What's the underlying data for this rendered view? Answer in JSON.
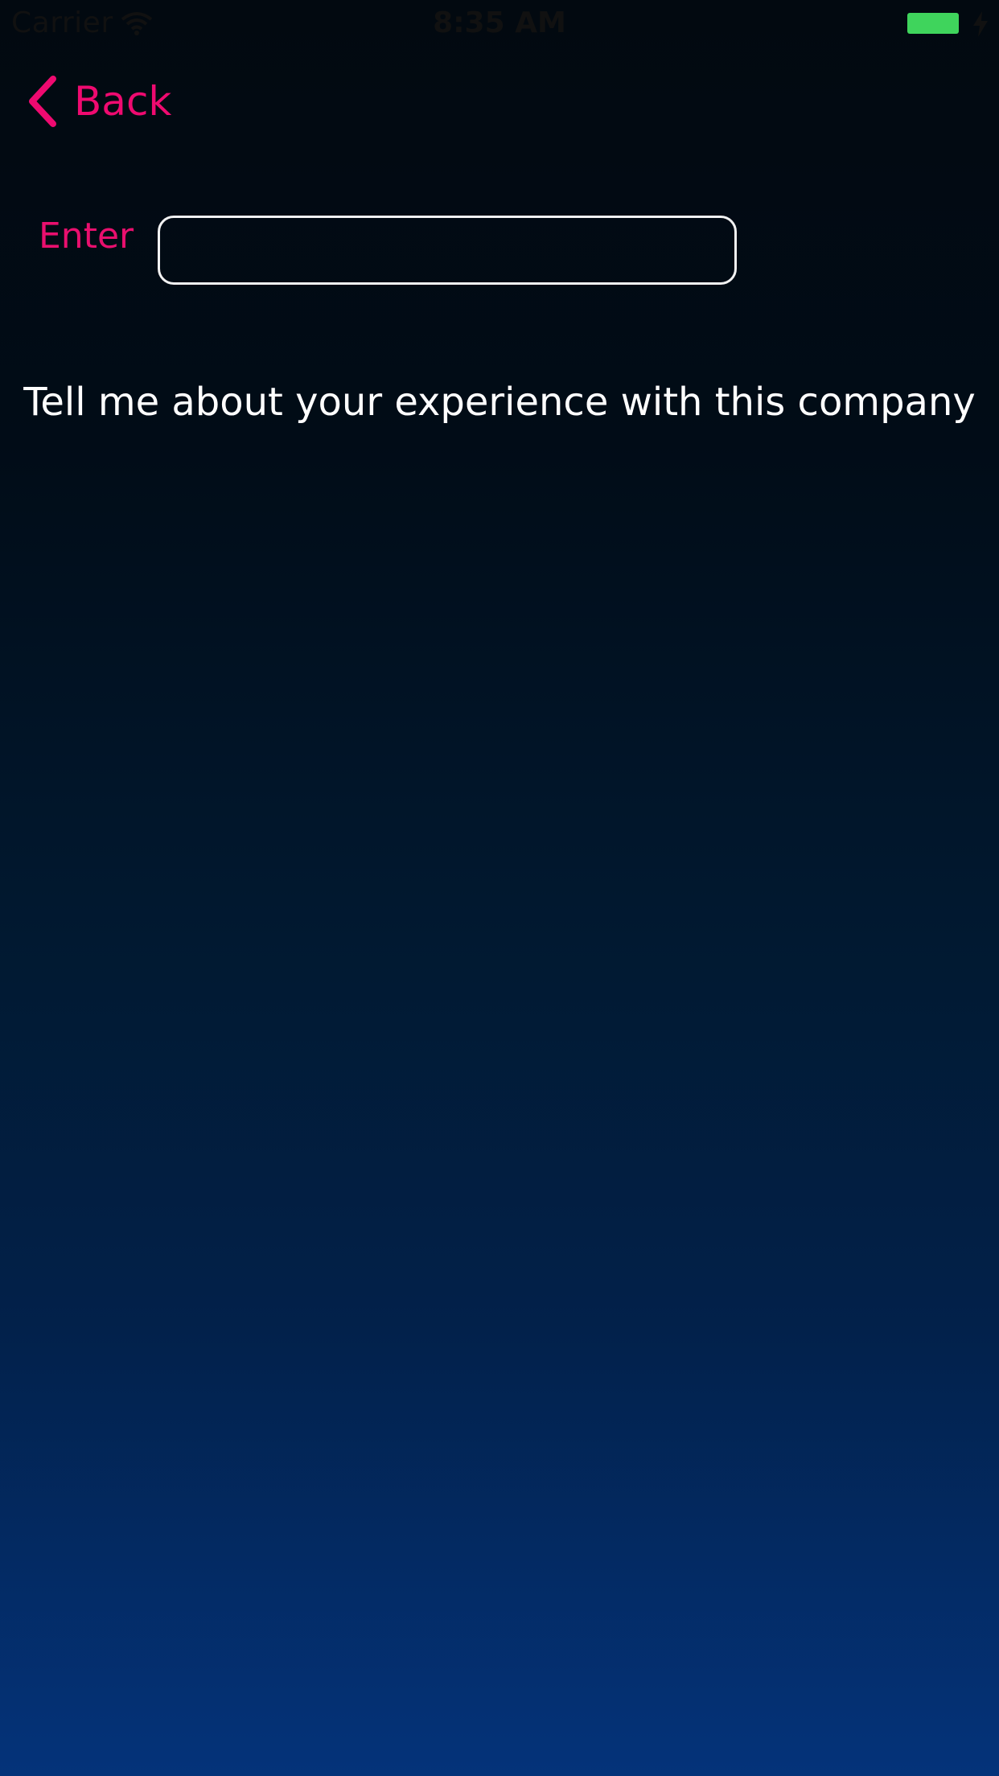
{
  "status_bar": {
    "carrier": "Carrier",
    "time": "8:35 AM",
    "battery_color": "#3fd45c"
  },
  "nav": {
    "back_label": "Back",
    "accent_color": "#ef0a70"
  },
  "form": {
    "enter_label": "Enter",
    "input_value": "",
    "input_placeholder": ""
  },
  "prompt": {
    "text": "Tell me about your experience with this company"
  }
}
